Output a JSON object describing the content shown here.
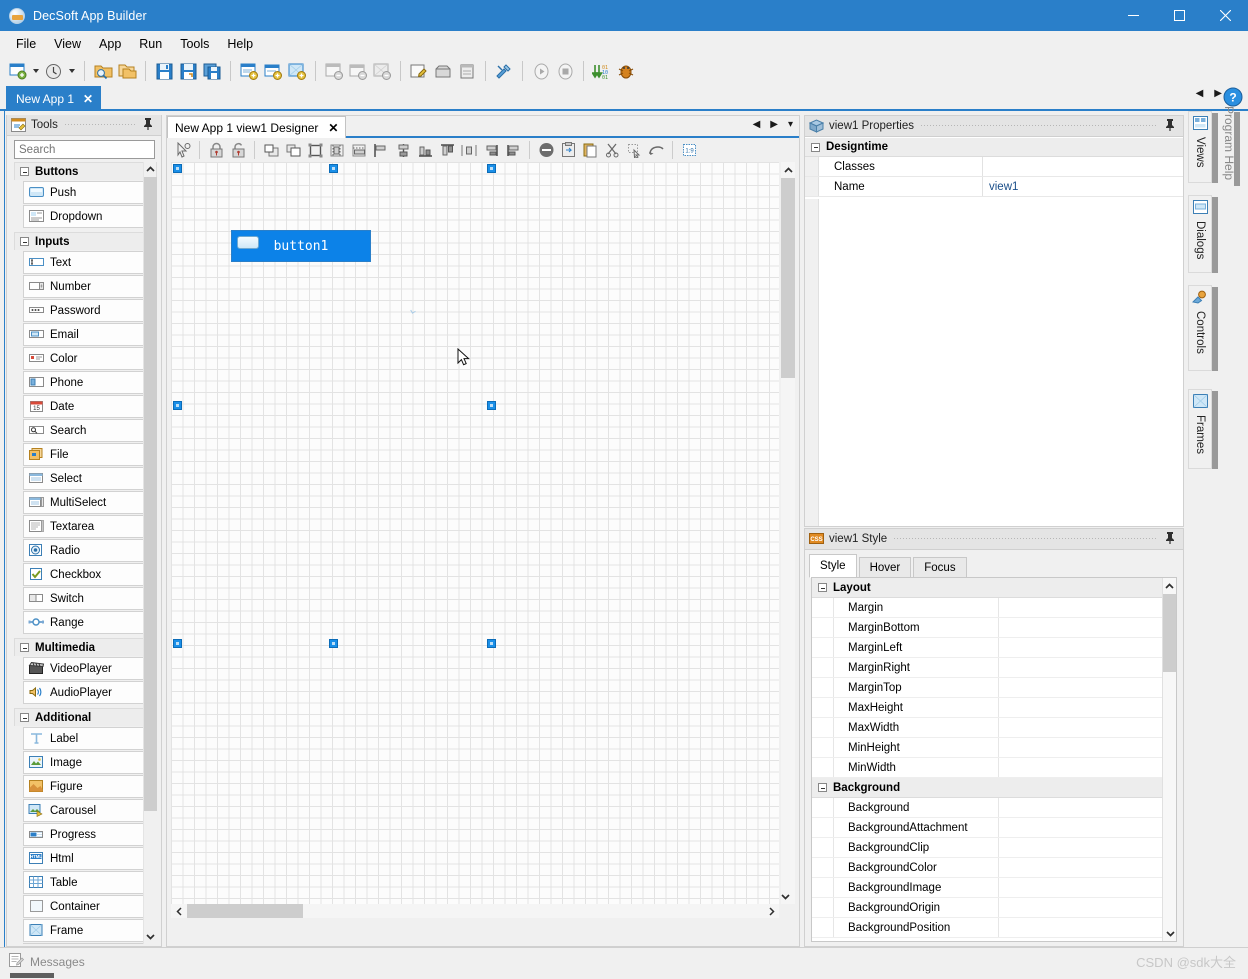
{
  "window": {
    "title": "DecSoft App Builder",
    "icon": "app-logo-icon",
    "minimize": "—",
    "maximize": "□",
    "close": "✕"
  },
  "menubar": {
    "items": [
      "File",
      "View",
      "App",
      "Run",
      "Tools",
      "Help"
    ]
  },
  "toolbar": {
    "groups": [
      {
        "buttons": [
          {
            "name": "new-app-button",
            "icon": "new-document-icon"
          },
          {
            "name": "new-app-dropdown",
            "icon": "chevron-down-icon"
          },
          {
            "name": "recent-apps-button",
            "icon": "clock-history-icon"
          },
          {
            "name": "recent-apps-dropdown",
            "icon": "chevron-down-icon"
          }
        ]
      },
      {
        "buttons": [
          {
            "name": "open-app-button",
            "icon": "open-folder-search-icon"
          },
          {
            "name": "open-folder-button",
            "icon": "folders-icon"
          }
        ]
      },
      {
        "buttons": [
          {
            "name": "save-button",
            "icon": "save-disk-icon"
          },
          {
            "name": "save-as-button",
            "icon": "save-as-icon"
          },
          {
            "name": "save-all-button",
            "icon": "save-all-icon"
          }
        ]
      },
      {
        "buttons": [
          {
            "name": "add-view-button",
            "icon": "add-view-icon"
          },
          {
            "name": "add-dialog-button",
            "icon": "add-dialog-icon"
          },
          {
            "name": "add-frame-button",
            "icon": "add-frame-icon"
          }
        ]
      },
      {
        "buttons": [
          {
            "name": "remove-view-button",
            "icon": "remove-view-icon"
          },
          {
            "name": "remove-dialog-button",
            "icon": "remove-dialog-icon"
          },
          {
            "name": "remove-frame-button",
            "icon": "remove-frame-icon"
          }
        ]
      },
      {
        "buttons": [
          {
            "name": "edit-code-button",
            "icon": "pencil-note-icon"
          },
          {
            "name": "archive-button",
            "icon": "box-icon"
          },
          {
            "name": "docked-panel-button",
            "icon": "panel-icon"
          }
        ]
      },
      {
        "buttons": [
          {
            "name": "app-options-button",
            "icon": "tools-wrench-icon"
          }
        ]
      },
      {
        "buttons": [
          {
            "name": "run-button",
            "icon": "play-circle-icon"
          },
          {
            "name": "stop-button",
            "icon": "stop-circle-icon"
          }
        ]
      },
      {
        "buttons": [
          {
            "name": "compile-button",
            "icon": "binary-download-icon"
          },
          {
            "name": "debug-button",
            "icon": "bug-icon"
          }
        ]
      }
    ]
  },
  "app_tabs": {
    "tabs": [
      {
        "label": "New App 1",
        "close": "✕",
        "active": true
      }
    ],
    "nav": {
      "prev": "◀",
      "next": "▶",
      "list": "▾"
    },
    "help_icon": "question-circle-icon"
  },
  "tools_panel": {
    "title": "Tools",
    "icon": "tools-panel-icon",
    "pin_icon": "pin-icon",
    "search": {
      "placeholder": "Search",
      "value": ""
    },
    "groups": [
      {
        "name": "Buttons",
        "items": [
          {
            "label": "Push",
            "icon": "push-button-icon"
          },
          {
            "label": "Dropdown",
            "icon": "dropdown-button-icon"
          }
        ]
      },
      {
        "name": "Inputs",
        "items": [
          {
            "label": "Text",
            "icon": "text-input-icon"
          },
          {
            "label": "Number",
            "icon": "number-input-icon"
          },
          {
            "label": "Password",
            "icon": "password-input-icon"
          },
          {
            "label": "Email",
            "icon": "email-input-icon"
          },
          {
            "label": "Color",
            "icon": "color-input-icon"
          },
          {
            "label": "Phone",
            "icon": "phone-input-icon"
          },
          {
            "label": "Date",
            "icon": "date-input-icon"
          },
          {
            "label": "Search",
            "icon": "search-input-icon"
          },
          {
            "label": "File",
            "icon": "file-input-icon"
          },
          {
            "label": "Select",
            "icon": "select-input-icon"
          },
          {
            "label": "MultiSelect",
            "icon": "multiselect-input-icon"
          },
          {
            "label": "Textarea",
            "icon": "textarea-input-icon"
          },
          {
            "label": "Radio",
            "icon": "radio-input-icon"
          },
          {
            "label": "Checkbox",
            "icon": "checkbox-input-icon"
          },
          {
            "label": "Switch",
            "icon": "switch-input-icon"
          },
          {
            "label": "Range",
            "icon": "range-input-icon"
          }
        ]
      },
      {
        "name": "Multimedia",
        "items": [
          {
            "label": "VideoPlayer",
            "icon": "video-player-icon"
          },
          {
            "label": "AudioPlayer",
            "icon": "audio-player-icon"
          }
        ]
      },
      {
        "name": "Additional",
        "items": [
          {
            "label": "Label",
            "icon": "label-icon"
          },
          {
            "label": "Image",
            "icon": "image-icon"
          },
          {
            "label": "Figure",
            "icon": "figure-icon"
          },
          {
            "label": "Carousel",
            "icon": "carousel-icon"
          },
          {
            "label": "Progress",
            "icon": "progress-icon"
          },
          {
            "label": "Html",
            "icon": "html-icon"
          },
          {
            "label": "Table",
            "icon": "table-icon"
          },
          {
            "label": "Container",
            "icon": "container-icon"
          },
          {
            "label": "Frame",
            "icon": "frame-icon"
          }
        ]
      }
    ]
  },
  "designer": {
    "tab": {
      "label": "New App 1 view1 Designer",
      "close": "✕"
    },
    "nav": {
      "prev": "◀",
      "next": "▶",
      "list": "▾"
    },
    "toolbar_buttons": [
      {
        "name": "select-tool-button",
        "icon": "arrow-select-icon"
      },
      {
        "name": "lock-controls-button",
        "icon": "lock-closed-icon"
      },
      {
        "name": "unlock-controls-button",
        "icon": "lock-open-icon"
      },
      {
        "name": "bring-to-front-button",
        "icon": "bring-front-icon"
      },
      {
        "name": "send-to-back-button",
        "icon": "send-back-icon"
      },
      {
        "name": "select-all-button",
        "icon": "select-all-icon"
      },
      {
        "name": "center-horizontally-button",
        "icon": "center-horizontal-icon"
      },
      {
        "name": "center-vertically-button",
        "icon": "center-vertical-icon"
      },
      {
        "name": "align-left-button",
        "icon": "align-left-icon"
      },
      {
        "name": "align-center-button",
        "icon": "align-center-icon"
      },
      {
        "name": "align-bottom-button",
        "icon": "align-bottom-icon"
      },
      {
        "name": "align-top-button",
        "icon": "align-top-icon"
      },
      {
        "name": "space-equally-horizontal-button",
        "icon": "space-horizontal-icon"
      },
      {
        "name": "align-right-button",
        "icon": "align-right-icon"
      },
      {
        "name": "align-middle-button",
        "icon": "align-middle-icon"
      },
      {
        "name": "delete-control-button",
        "icon": "delete-circle-icon"
      },
      {
        "name": "copy-control-button",
        "icon": "copy-icon"
      },
      {
        "name": "paste-control-button",
        "icon": "paste-icon"
      },
      {
        "name": "cut-control-button",
        "icon": "scissors-icon"
      },
      {
        "name": "duplicate-control-button",
        "icon": "duplicate-icon"
      },
      {
        "name": "undo-button",
        "icon": "undo-arrow-icon"
      },
      {
        "name": "snap-to-grid-button",
        "icon": "grid-snap-icon"
      }
    ],
    "canvas": {
      "control": {
        "label": "button1",
        "icon": "push-button-icon"
      },
      "selection_handles": 6,
      "cursor": "mouse-pointer-icon"
    }
  },
  "properties_panel": {
    "title": "view1 Properties",
    "icon": "properties-box-icon",
    "pin_icon": "pin-icon",
    "category": "Designtime",
    "rows": [
      {
        "name": "Classes",
        "value": ""
      },
      {
        "name": "Name",
        "value": "view1"
      }
    ]
  },
  "style_panel": {
    "title": "view1 Style",
    "icon": "css-icon",
    "pin_icon": "pin-icon",
    "tabs": [
      {
        "label": "Style",
        "active": true
      },
      {
        "label": "Hover",
        "active": false
      },
      {
        "label": "Focus",
        "active": false
      }
    ],
    "sections": [
      {
        "name": "Layout",
        "properties": [
          {
            "name": "Margin",
            "value": ""
          },
          {
            "name": "MarginBottom",
            "value": ""
          },
          {
            "name": "MarginLeft",
            "value": ""
          },
          {
            "name": "MarginRight",
            "value": ""
          },
          {
            "name": "MarginTop",
            "value": ""
          },
          {
            "name": "MaxHeight",
            "value": ""
          },
          {
            "name": "MaxWidth",
            "value": ""
          },
          {
            "name": "MinHeight",
            "value": ""
          },
          {
            "name": "MinWidth",
            "value": ""
          }
        ]
      },
      {
        "name": "Background",
        "properties": [
          {
            "name": "Background",
            "value": ""
          },
          {
            "name": "BackgroundAttachment",
            "value": ""
          },
          {
            "name": "BackgroundClip",
            "value": ""
          },
          {
            "name": "BackgroundColor",
            "value": ""
          },
          {
            "name": "BackgroundImage",
            "value": ""
          },
          {
            "name": "BackgroundOrigin",
            "value": ""
          },
          {
            "name": "BackgroundPosition",
            "value": ""
          }
        ]
      }
    ]
  },
  "right_rail": {
    "program_help": "Program Help",
    "tabs": [
      {
        "label": "Views",
        "icon": "views-icon"
      },
      {
        "label": "Dialogs",
        "icon": "dialogs-icon"
      },
      {
        "label": "Controls",
        "icon": "controls-icon"
      },
      {
        "label": "Frames",
        "icon": "frames-icon"
      }
    ]
  },
  "status_bar": {
    "messages_label": "Messages",
    "messages_icon": "messages-icon",
    "watermark": "CSDN @sdk大全"
  },
  "colors": {
    "accent": "#2a7fc9",
    "button_blue": "#0c82e8",
    "panel_bg": "#f0f0f0",
    "handle_blue": "#1a8fe8"
  }
}
